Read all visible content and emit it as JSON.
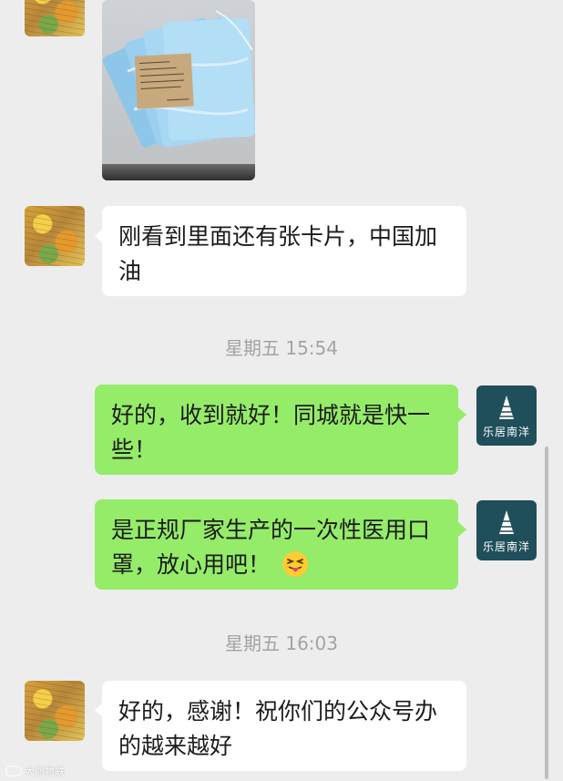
{
  "messages": {
    "card_message": "刚看到里面还有张卡片，中国加油",
    "reply_received": "好的，收到就好！同城就是快一些！",
    "reply_quality": "是正规厂家生产的一次性医用口罩，放心用吧！",
    "thanks_message": "好的，感谢！祝你们的公众号办的越来越好"
  },
  "timestamps": {
    "t1": "星期五 15:54",
    "t2": "星期五 16:03"
  },
  "brand_avatar": {
    "name": "乐居南洋"
  },
  "watermark": {
    "text": "大鹍物联"
  },
  "colors": {
    "background": "#ededed",
    "bubble_green": "#95ec69",
    "bubble_white": "#ffffff",
    "brand_teal": "#1f4f5a",
    "timestamp_gray": "#a3a3a3"
  },
  "icons": {
    "emoji": "squinting-tongue-emoji",
    "brand_logo": "building-logo-icon"
  }
}
